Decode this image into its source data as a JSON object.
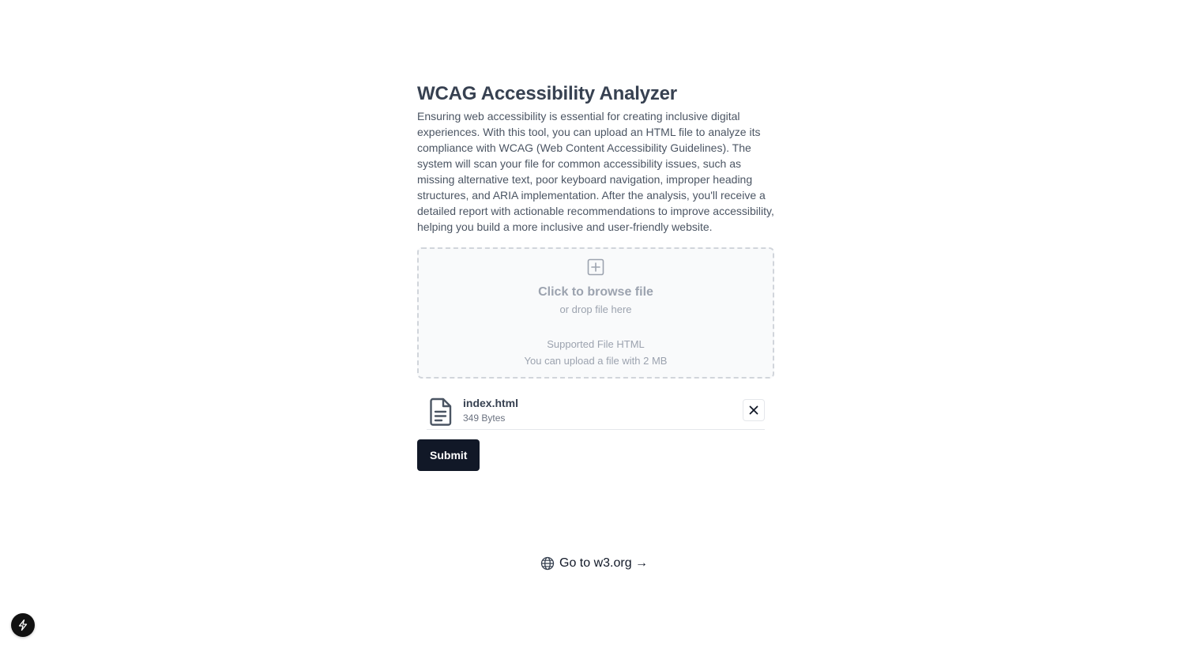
{
  "header": {
    "title": "WCAG Accessibility Analyzer",
    "description": "Ensuring web accessibility is essential for creating inclusive digital experiences. With this tool, you can upload an HTML file to analyze its compliance with WCAG (Web Content Accessibility Guidelines). The system will scan your file for common accessibility issues, such as missing alternative text, poor keyboard navigation, improper heading structures, and ARIA implementation. After the analysis, you'll receive a detailed report with actionable recommendations to improve accessibility, helping you build a more inclusive and user-friendly website."
  },
  "dropzone": {
    "browse_label": "Click to browse file",
    "drop_label": "or drop file here",
    "supported_label": "Supported File HTML",
    "size_limit_label": "You can upload a file with 2 MB",
    "icon": "plus-square-icon"
  },
  "uploaded_file": {
    "name": "index.html",
    "size": "349 Bytes",
    "icon": "document-icon",
    "remove_icon": "close-icon"
  },
  "actions": {
    "submit_label": "Submit"
  },
  "footer": {
    "link_label": "Go to w3.org →",
    "icon": "globe-icon"
  },
  "badge": {
    "icon": "bolt-icon"
  },
  "colors": {
    "primary_button": "#111827",
    "title": "#374151",
    "muted_text": "#9ca3af",
    "dropzone_border": "#d1d5db"
  }
}
